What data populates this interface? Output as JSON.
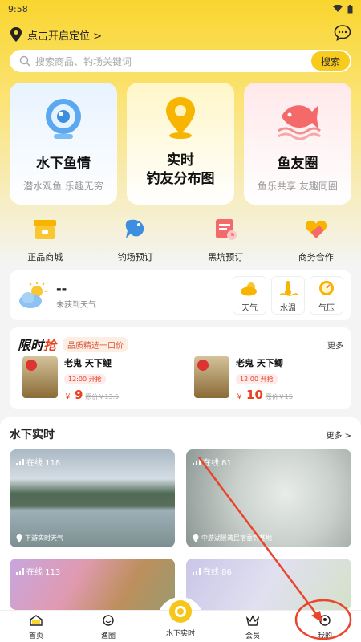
{
  "status": {
    "time": "9:58"
  },
  "header": {
    "location_label": "点击开启定位 >"
  },
  "search": {
    "placeholder": "搜索商品、钓场关键词",
    "button": "搜索"
  },
  "big_cards": [
    {
      "title": "水下鱼情",
      "subtitle": "潜水观鱼  乐趣无穷"
    },
    {
      "title_line1": "实时",
      "title_line2": "钓友分布图"
    },
    {
      "title": "鱼友圈",
      "subtitle": "鱼乐共享  友趣同圈"
    }
  ],
  "quick": [
    {
      "label": "正品商城",
      "icon": "mall-icon"
    },
    {
      "label": "钓场预订",
      "icon": "fish-icon"
    },
    {
      "label": "黑坑预订",
      "icon": "calendar-icon"
    },
    {
      "label": "商务合作",
      "icon": "handshake-icon"
    }
  ],
  "weather": {
    "temp": "--",
    "status": "未获到天气",
    "buttons": [
      "天气",
      "水温",
      "气压"
    ]
  },
  "flash_sale": {
    "logo_a": "限时",
    "logo_b": "抢",
    "tag": "品质精选一口价",
    "more": "更多",
    "products": [
      {
        "name": "老鬼 天下鲤",
        "time": "12:00 开抢",
        "currency": "￥",
        "price": "9",
        "orig": "原价￥13.5"
      },
      {
        "name": "老鬼 天下鲫",
        "time": "12:00 开抢",
        "currency": "￥",
        "price": "10",
        "orig": "原价￥15"
      }
    ]
  },
  "underwater": {
    "title": "水下实时",
    "more": "更多 >",
    "cams": [
      {
        "online": "在线 118",
        "place": "下游实时天气"
      },
      {
        "online": "在线 81",
        "place": "中游湖景湾民宿垂钓基地"
      },
      {
        "online": "在线 113"
      },
      {
        "online": "在线 86"
      }
    ]
  },
  "tabs": [
    "首页",
    "渔圈",
    "水下实时",
    "会员",
    "我的"
  ],
  "colors": {
    "brand_yellow": "#f9d52e",
    "annotation_red": "#e8452c"
  }
}
